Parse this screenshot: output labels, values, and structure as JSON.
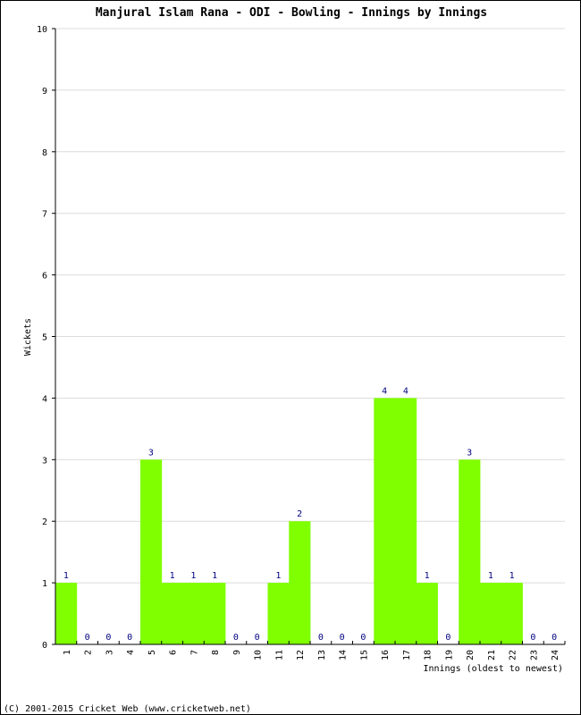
{
  "chart_data": {
    "type": "bar",
    "title": "Manjural Islam Rana - ODI - Bowling - Innings by Innings",
    "xlabel": "Innings (oldest to newest)",
    "ylabel": "Wickets",
    "ylim": [
      0,
      10
    ],
    "yticks": [
      "0",
      "1",
      "2",
      "3",
      "4",
      "5",
      "6",
      "7",
      "8",
      "9",
      "10"
    ],
    "grid": true,
    "categories": [
      "1",
      "2",
      "3",
      "4",
      "5",
      "6",
      "7",
      "8",
      "9",
      "10",
      "11",
      "12",
      "13",
      "14",
      "15",
      "16",
      "17",
      "18",
      "19",
      "20",
      "21",
      "22",
      "23",
      "24"
    ],
    "values": [
      1,
      0,
      0,
      0,
      3,
      1,
      1,
      1,
      0,
      0,
      1,
      2,
      0,
      0,
      0,
      4,
      4,
      1,
      0,
      3,
      1,
      1,
      0,
      0
    ],
    "bar_color": "#80ff00",
    "label_color": "#000080"
  },
  "footer": "(C) 2001-2015 Cricket Web (www.cricketweb.net)"
}
